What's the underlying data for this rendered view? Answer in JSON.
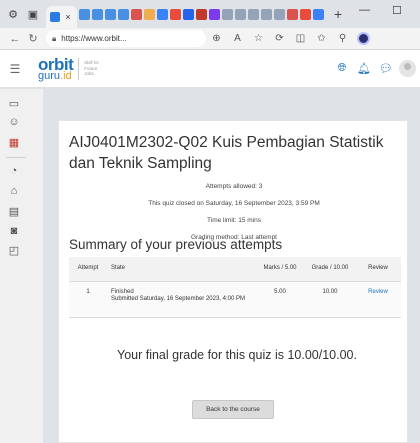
{
  "browser": {
    "active_tab_favicon_color": "#2a7be4",
    "mini_tab_colors": [
      "#4a90e2",
      "#4a90e2",
      "#4a90e2",
      "#4a90e2",
      "#d9534f",
      "#f0ad4e",
      "#3b82f6",
      "#e74c3c",
      "#2563eb",
      "#c0392b",
      "#7c3aed",
      "#94a3b8",
      "#94a3b8",
      "#94a3b8",
      "#94a3b8",
      "#94a3b8",
      "#d9534f",
      "#e74c3c",
      "#3b82f6"
    ],
    "new_tab": "+",
    "close_glyph": "×",
    "url": "https://www.orbit...",
    "window_min": "—",
    "window_max": "☐"
  },
  "site": {
    "logo_main": "orbit",
    "logo_sub_a": "guru",
    "logo_sub_b": ".id",
    "logo_tagline": "Skill for Future Jobs"
  },
  "quiz": {
    "title": "AIJ0401M2302-Q02 Kuis Pembagian Statistik dan Teknik Sampling",
    "attempts_allowed": "Attempts allowed: 3",
    "closed_on": "This quiz closed on Saturday, 16 September 2023, 3:59 PM",
    "time_limit": "Time limit: 15 mins",
    "grading_method": "Grading method: Last attempt"
  },
  "summary": {
    "heading": "Summary of your previous attempts",
    "headers": {
      "attempt": "Attempt",
      "state": "State",
      "marks": "Marks / 5.00",
      "grade": "Grade / 10.00",
      "review": "Review"
    },
    "rows": [
      {
        "attempt": "1",
        "state": "Finished",
        "submitted": "Submitted Saturday, 16 September 2023, 4:00 PM",
        "marks": "5.00",
        "grade": "10.00",
        "review": "Review"
      }
    ]
  },
  "final_grade": "Your final grade for this quiz is 10.00/10.00.",
  "back_button": "Back to the course"
}
